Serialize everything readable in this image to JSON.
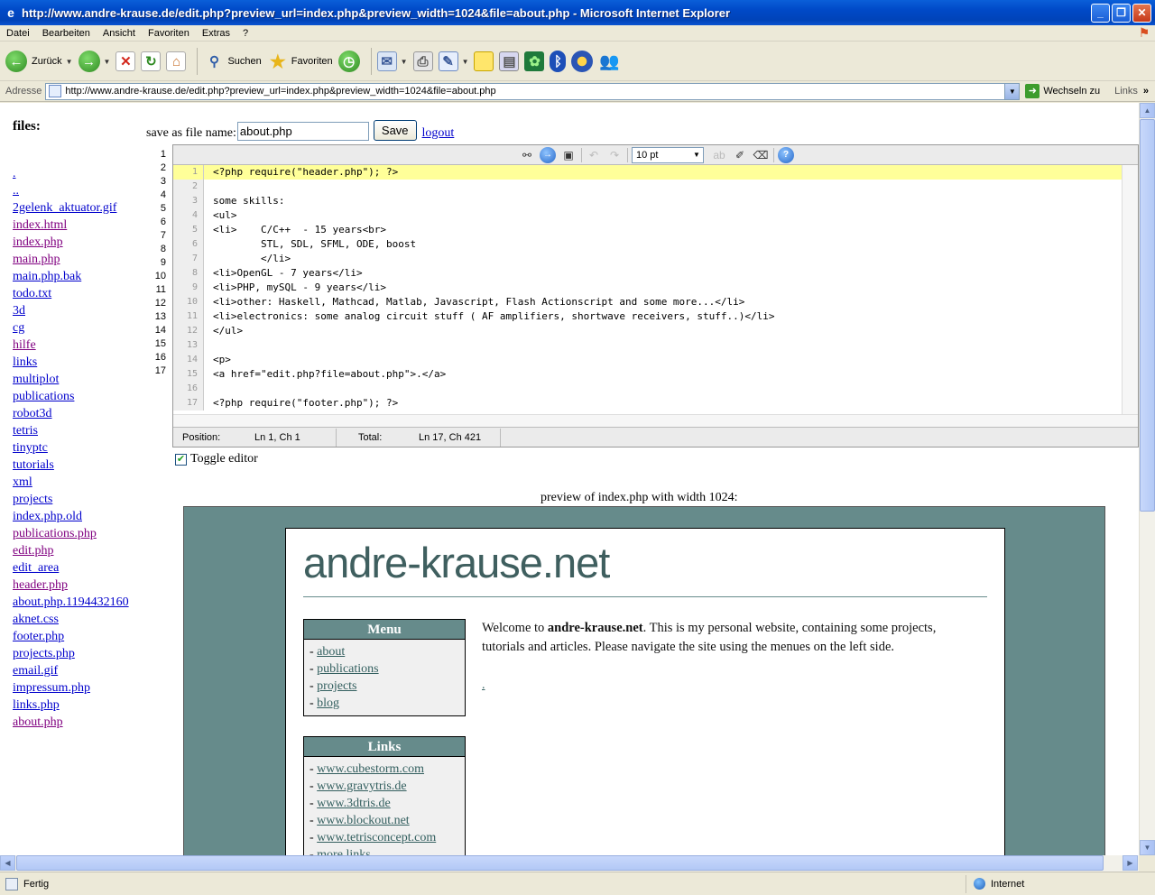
{
  "window": {
    "title": "http://www.andre-krause.de/edit.php?preview_url=index.php&preview_width=1024&file=about.php - Microsoft Internet Explorer"
  },
  "menu": [
    "Datei",
    "Bearbeiten",
    "Ansicht",
    "Favoriten",
    "Extras",
    "?"
  ],
  "toolbar": {
    "back_label": "Zurück",
    "search_label": "Suchen",
    "favorites_label": "Favoriten"
  },
  "address": {
    "label": "Adresse",
    "url": "http://www.andre-krause.de/edit.php?preview_url=index.php&preview_width=1024&file=about.php",
    "go_label": "Wechseln zu",
    "links_label": "Links"
  },
  "files": {
    "header": "files:",
    "items": [
      {
        "name": ".",
        "visited": false
      },
      {
        "name": "..",
        "visited": false
      },
      {
        "name": "2gelenk_aktuator.gif",
        "visited": false
      },
      {
        "name": "index.html",
        "visited": true
      },
      {
        "name": "index.php",
        "visited": true
      },
      {
        "name": "main.php",
        "visited": true
      },
      {
        "name": "main.php.bak",
        "visited": false
      },
      {
        "name": "todo.txt",
        "visited": false
      },
      {
        "name": "3d",
        "visited": false
      },
      {
        "name": "cg",
        "visited": false
      },
      {
        "name": "hilfe",
        "visited": true
      },
      {
        "name": "links",
        "visited": false
      },
      {
        "name": "multiplot",
        "visited": false
      },
      {
        "name": "publications",
        "visited": false
      },
      {
        "name": "robot3d",
        "visited": false
      },
      {
        "name": "tetris",
        "visited": false
      },
      {
        "name": "tinyptc",
        "visited": false
      },
      {
        "name": "tutorials",
        "visited": false
      },
      {
        "name": "xml",
        "visited": false
      },
      {
        "name": "projects",
        "visited": false
      },
      {
        "name": "index.php.old",
        "visited": false
      },
      {
        "name": "publications.php",
        "visited": true
      },
      {
        "name": "edit.php",
        "visited": true
      },
      {
        "name": "edit_area",
        "visited": false
      },
      {
        "name": "header.php",
        "visited": true
      },
      {
        "name": "about.php.1194432160",
        "visited": false
      },
      {
        "name": "aknet.css",
        "visited": false
      },
      {
        "name": "footer.php",
        "visited": false
      },
      {
        "name": "projects.php",
        "visited": false
      },
      {
        "name": "email.gif",
        "visited": false
      },
      {
        "name": "impressum.php",
        "visited": false
      },
      {
        "name": "links.php",
        "visited": false
      },
      {
        "name": "about.php",
        "visited": true
      }
    ]
  },
  "save": {
    "label": "save as file name:",
    "filename": "about.php",
    "button": "Save",
    "logout": "logout"
  },
  "editor": {
    "font_size": "10 pt",
    "lines": [
      "<?php require(\"header.php\"); ?>",
      "",
      "some skills:",
      "<ul>",
      "<li>    C/C++  - 15 years<br>",
      "        STL, SDL, SFML, ODE, boost",
      "        </li>",
      "<li>OpenGL - 7 years</li>",
      "<li>PHP, mySQL - 9 years</li>",
      "<li>other: Haskell, Mathcad, Matlab, Javascript, Flash Actionscript and some more...</li>",
      "<li>electronics: some analog circuit stuff ( AF amplifiers, shortwave receivers, stuff..)</li>",
      "</ul>",
      "",
      "<p>",
      "<a href=\"edit.php?file=about.php\">.</a>",
      "",
      "<?php require(\"footer.php\"); ?>"
    ],
    "status": {
      "position_label": "Position:",
      "position_value": "Ln 1, Ch 1",
      "total_label": "Total:",
      "total_value": "Ln 17, Ch 421"
    }
  },
  "toggle_editor": "Toggle editor",
  "preview": {
    "caption": "preview of index.php with width 1024:",
    "brand": "andre-krause.net",
    "menu_title": "Menu",
    "menu_items": [
      "about",
      "publications",
      "projects",
      "blog"
    ],
    "links_title": "Links",
    "links_items": [
      "www.cubestorm.com",
      "www.gravytris.de",
      "www.3dtris.de",
      "www.blockout.net",
      "www.tetrisconcept.com",
      "more links"
    ],
    "welcome_pre": "Welcome to ",
    "welcome_bold": "andre-krause.net",
    "welcome_post": ". This is my personal website, containing some projects, tutorials and articles. Please navigate the site using the menues on the left side.",
    "dot_link": "."
  },
  "status": {
    "text": "Fertig",
    "zone": "Internet"
  },
  "colors": {
    "preview_bg": "#668b8b",
    "title_blue": "#0049c7"
  }
}
